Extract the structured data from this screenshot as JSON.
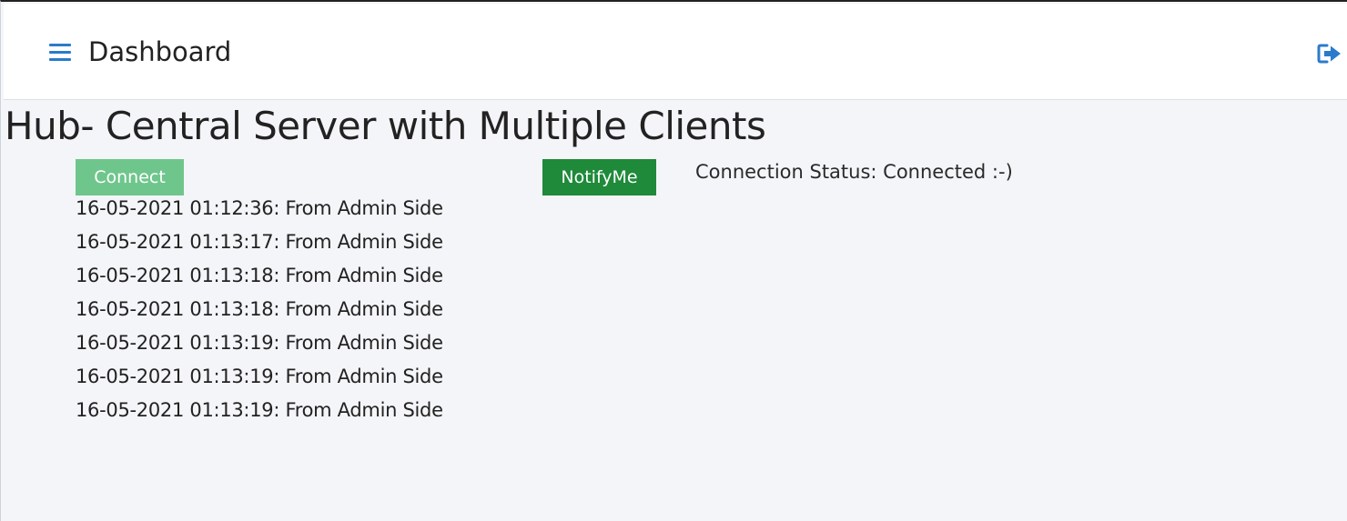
{
  "header": {
    "title": "Dashboard",
    "menu_icon": "hamburger-menu-icon",
    "logout_icon": "sign-out-icon",
    "accent_color": "#2a7bcb"
  },
  "main": {
    "title": "Hub- Central Server with Multiple Clients",
    "connect_label": "Connect",
    "notify_label": "NotifyMe",
    "status_text": "Connection Status: Connected :-)",
    "connect_color": "#6fc68c",
    "notify_color": "#1e8a3a",
    "messages": [
      "16-05-2021 01:12:36: From Admin Side",
      "16-05-2021 01:13:17: From Admin Side",
      "16-05-2021 01:13:18: From Admin Side",
      "16-05-2021 01:13:18: From Admin Side",
      "16-05-2021 01:13:19: From Admin Side",
      "16-05-2021 01:13:19: From Admin Side",
      "16-05-2021 01:13:19: From Admin Side"
    ]
  }
}
